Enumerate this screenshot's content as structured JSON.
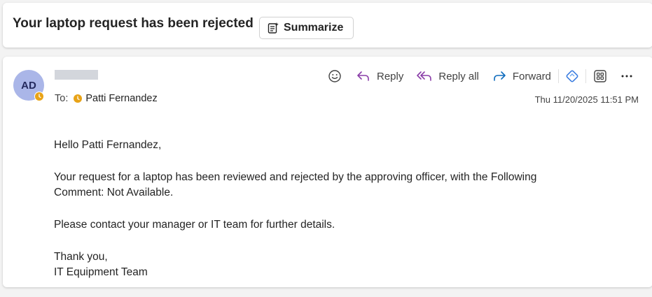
{
  "subject": {
    "title": "Your laptop request has been rejected",
    "summarize_label": "Summarize"
  },
  "message": {
    "avatar_initials": "AD",
    "to_label": "To:",
    "recipient": "Patti Fernandez",
    "timestamp": "Thu 11/20/2025 11:51 PM",
    "actions": {
      "reply": "Reply",
      "reply_all": "Reply all",
      "forward": "Forward"
    },
    "body": {
      "greeting": "Hello Patti Fernandez,",
      "line1": "Your request for a laptop has been reviewed and rejected by the approving officer, with the Following",
      "line2": "Comment: Not Available.",
      "line3": "Please contact your manager or IT team for further details.",
      "signoff1": "Thank you,",
      "signoff2": "IT Equipment Team"
    }
  },
  "colors": {
    "accent": "#5b5fc7",
    "reply_icon": "#8a3ea8",
    "forward_icon": "#0f6cbd",
    "avatar_bg": "#aab6e8",
    "presence": "#e8a317"
  }
}
